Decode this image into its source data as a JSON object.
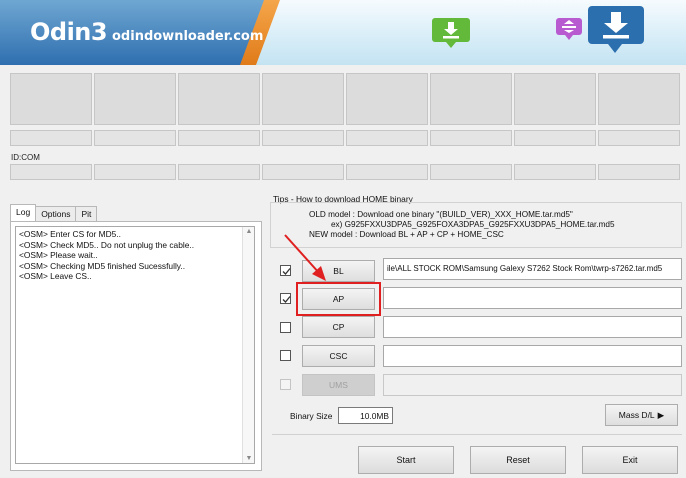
{
  "header": {
    "logo_title": "Odin3",
    "logo_url": "odindownloader.com",
    "colors": {
      "banner_blue": "#2f6fb0",
      "banner_orange": "#e07b1a",
      "icon_green": "#63b93a",
      "icon_purple": "#b85ad0",
      "icon_blue": "#2c6fae"
    },
    "icons": [
      "download-icon",
      "upload-download-icon",
      "download-icon"
    ]
  },
  "ports": {
    "id_com_label": "ID:COM"
  },
  "tabs": [
    {
      "label": "Log",
      "active": true
    },
    {
      "label": "Options",
      "active": false
    },
    {
      "label": "Pit",
      "active": false
    }
  ],
  "log": {
    "lines": [
      "<OSM> Enter CS for MD5..",
      "<OSM> Check MD5.. Do not unplug the cable..",
      "<OSM> Please wait..",
      "<OSM> Checking MD5 finished Sucessfully..",
      "<OSM> Leave CS.."
    ]
  },
  "tips": {
    "title": "Tips - How to download HOME binary",
    "old_model": "OLD model  : Download one binary    \"(BUILD_VER)_XXX_HOME.tar.md5\"",
    "example": "ex) G925FXXU3DPA5_G925FOXA3DPA5_G925FXXU3DPA5_HOME.tar.md5",
    "new_model": "NEW model : Download BL + AP + CP + HOME_CSC"
  },
  "files": [
    {
      "label": "BL",
      "checked": true,
      "enabled": true,
      "path": "ile\\ALL STOCK ROM\\Samsung Galexy S7262 Stock Rom\\twrp-s7262.tar.md5"
    },
    {
      "label": "AP",
      "checked": true,
      "enabled": true,
      "path": ""
    },
    {
      "label": "CP",
      "checked": false,
      "enabled": true,
      "path": ""
    },
    {
      "label": "CSC",
      "checked": false,
      "enabled": true,
      "path": ""
    },
    {
      "label": "UMS",
      "checked": false,
      "enabled": false,
      "path": ""
    }
  ],
  "binary": {
    "label": "Binary Size",
    "value": "10.0MB"
  },
  "buttons": {
    "mass_dl": "Mass D/L",
    "start": "Start",
    "reset": "Reset",
    "exit": "Exit"
  },
  "annotation": {
    "highlight_color": "#e02020",
    "highlighted": "AP"
  }
}
